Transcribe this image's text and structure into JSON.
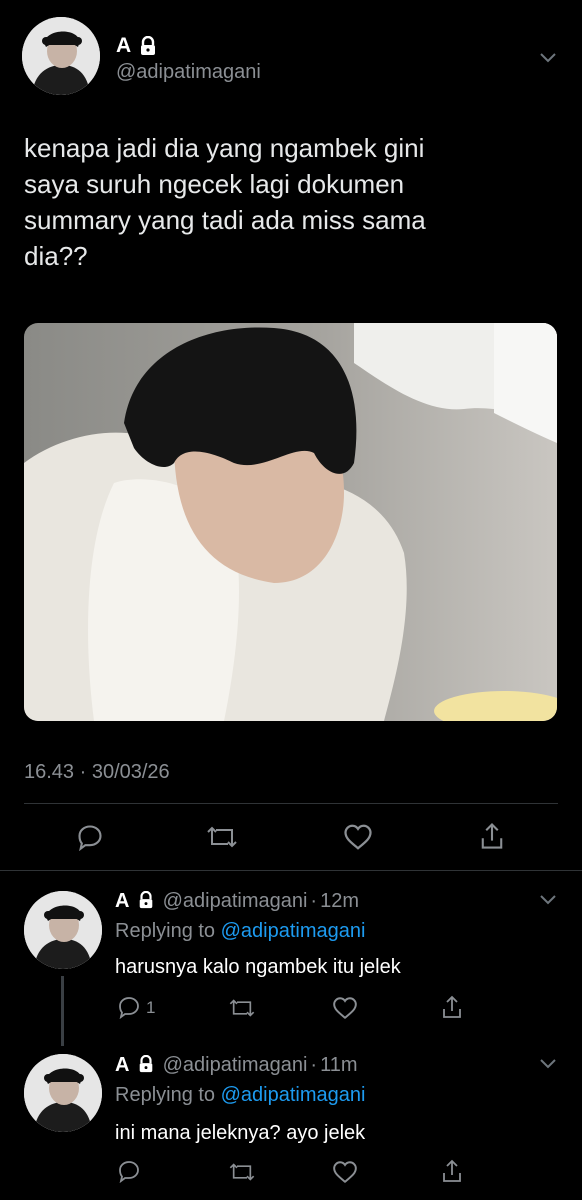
{
  "tweet": {
    "author": {
      "name": "A",
      "handle": "@adipatimagani"
    },
    "text_lines": [
      "kenapa jadi dia yang ngambek gini",
      "saya suruh ngecek lagi dokumen",
      "summary yang tadi ada miss sama",
      "dia??"
    ],
    "timestamp": "16.43 · 30/03/26"
  },
  "replies": [
    {
      "name": "A",
      "handle": "@adipatimagani",
      "sep": "·",
      "time": "12m",
      "replying_prefix": "Replying to",
      "replying_handle": "@adipatimagani",
      "text": "harusnya kalo ngambek itu jelek",
      "reply_count": "1"
    },
    {
      "name": "A",
      "handle": "@adipatimagani",
      "sep": "·",
      "time": "11m",
      "replying_prefix": "Replying to",
      "replying_handle": "@adipatimagani",
      "text": "ini mana jeleknya? ayo jelek",
      "reply_count": ""
    }
  ],
  "icons": {
    "lock": "lock-icon",
    "chevron": "chevron-down-icon",
    "reply": "reply-icon",
    "retweet": "retweet-icon",
    "like": "heart-icon",
    "share": "share-icon"
  },
  "colors": {
    "background": "#000000",
    "text": "#e7e9ea",
    "muted": "#8b8f94",
    "link": "#1d9bf0",
    "divider": "#2f3336"
  }
}
